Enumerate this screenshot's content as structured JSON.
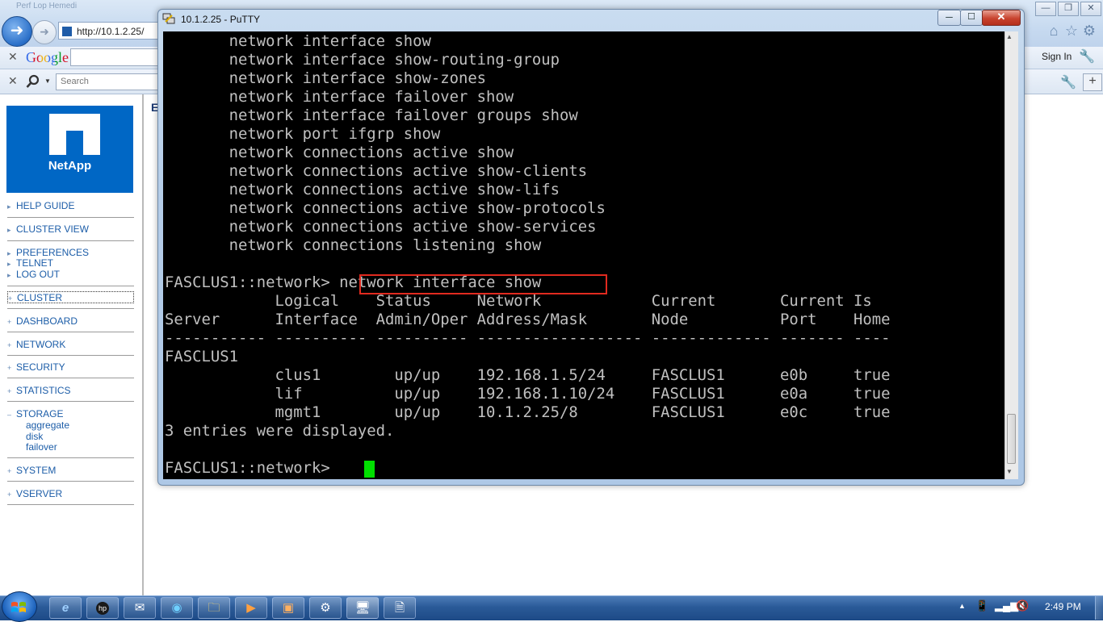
{
  "ie": {
    "title_fragment": "Perf  Lop  Hemedi",
    "address": "http://10.1.2.25/",
    "google_label": "Google",
    "search_placeholder": "Search",
    "sign_in": "Sign In"
  },
  "nav": {
    "logo_text": "NetApp",
    "items": [
      {
        "label": "HELP GUIDE",
        "prefix": "▸"
      },
      {
        "label": "CLUSTER VIEW",
        "prefix": "▸"
      },
      {
        "label": "PREFERENCES",
        "prefix": "▸"
      },
      {
        "label": "TELNET",
        "prefix": "▸"
      },
      {
        "label": "LOG OUT",
        "prefix": "▸"
      },
      {
        "label": "CLUSTER",
        "prefix": "+"
      },
      {
        "label": "DASHBOARD",
        "prefix": "+"
      },
      {
        "label": "NETWORK",
        "prefix": "+"
      },
      {
        "label": "SECURITY",
        "prefix": "+"
      },
      {
        "label": "STATISTICS",
        "prefix": "+"
      },
      {
        "label": "STORAGE",
        "prefix": "–"
      },
      {
        "label": "SYSTEM",
        "prefix": "+"
      },
      {
        "label": "VSERVER",
        "prefix": "+"
      }
    ],
    "storage_subitems": [
      "aggregate",
      "disk",
      "failover"
    ],
    "content_letter": "E"
  },
  "putty": {
    "title": "10.1.2.25 - PuTTY",
    "lines": [
      "       network interface show",
      "       network interface show-routing-group",
      "       network interface show-zones",
      "       network interface failover show",
      "       network interface failover groups show",
      "       network port ifgrp show",
      "       network connections active show",
      "       network connections active show-clients",
      "       network connections active show-lifs",
      "       network connections active show-protocols",
      "       network connections active show-services",
      "       network connections listening show",
      "",
      "FASCLUS1::network> network interface show",
      "            Logical    Status     Network            Current       Current Is",
      "Server      Interface  Admin/Oper Address/Mask       Node          Port    Home",
      "----------- ---------- ---------- ------------------ ------------- ------- ----",
      "FASCLUS1",
      "            clus1        up/up    192.168.1.5/24     FASCLUS1      e0b     true",
      "            lif          up/up    192.168.1.10/24    FASCLUS1      e0a     true",
      "            mgmt1        up/up    10.1.2.25/8        FASCLUS1      e0c     true",
      "3 entries were displayed.",
      "",
      "FASCLUS1::network> "
    ],
    "highlighted_command": "network interface show"
  },
  "taskbar": {
    "clock": "2:49 PM",
    "buttons": [
      "ie",
      "hp",
      "outlook",
      "media-center",
      "explorer",
      "media-player",
      "paint",
      "control",
      "putty",
      "notepad"
    ]
  },
  "colors": {
    "terminal_bg": "#000000",
    "terminal_fg": "#c0c0c0",
    "cursor": "#00e000",
    "highlight_box": "#e12a1f",
    "netapp_blue": "#0067c5",
    "nav_link": "#1c5da8"
  }
}
